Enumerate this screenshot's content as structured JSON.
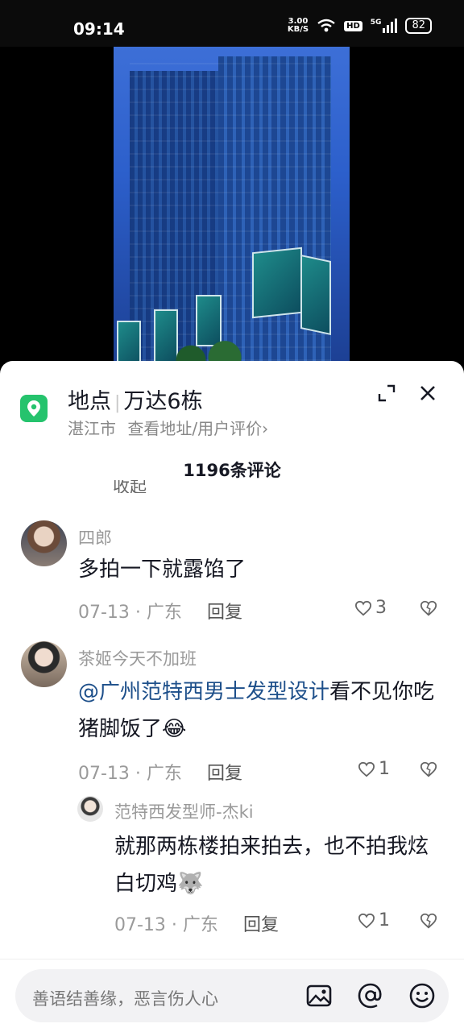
{
  "status_bar": {
    "time": "09:14",
    "net_speed_value": "3.00",
    "net_speed_unit": "KB/S",
    "hd_label": "HD",
    "network": "5G",
    "battery": "82"
  },
  "location": {
    "label": "地点",
    "place": "万达6栋",
    "city": "湛江市",
    "link": "查看地址/用户评价›"
  },
  "comments_header": {
    "count_text": "1196条评论",
    "cut_off_text": "收起"
  },
  "comments": [
    {
      "username": "四郎",
      "text": "多拍一下就露馅了",
      "date": "07-13",
      "region": "广东",
      "reply_label": "回复",
      "likes": "3"
    },
    {
      "username": "茶姬今天不加班",
      "mention": "@广州范特西男士发型设计",
      "text": "看不见你吃猪脚饭了😂",
      "date": "07-13",
      "region": "广东",
      "reply_label": "回复",
      "likes": "1"
    }
  ],
  "reply": {
    "username": "范特西发型师-杰ki",
    "text": "就那两栋楼拍来拍去，也不拍我炫白切鸡🐺",
    "date": "07-13",
    "region": "广东",
    "reply_label": "回复",
    "likes": "1"
  },
  "input_bar": {
    "placeholder": "善语结善缘，恶言伤人心"
  },
  "colors": {
    "accent_green": "#25c36d",
    "mention_blue": "#1d4f8a"
  }
}
